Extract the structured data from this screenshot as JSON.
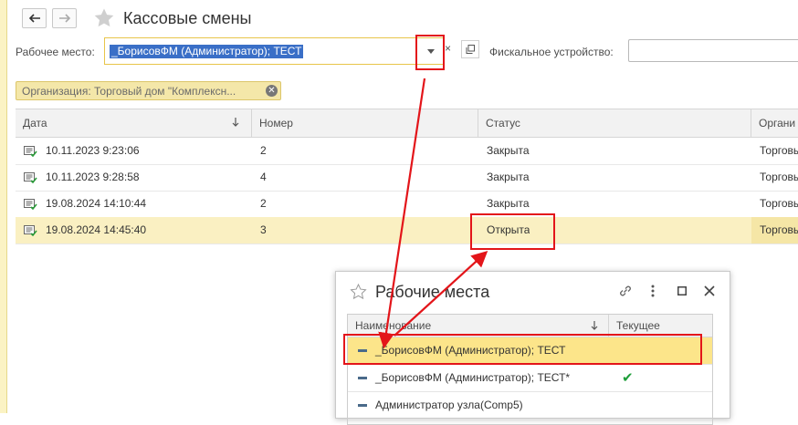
{
  "window": {
    "title": "Кассовые смены"
  },
  "filters": {
    "workplace_label": "Рабочее место:",
    "workplace_value": "_БорисовФМ (Администратор); ТЕСТ",
    "fiscal_label": "Фискальное устройство:",
    "fiscal_value": "",
    "org_chip": "Организация: Торговый дом \"Комплексн..."
  },
  "grid": {
    "columns": [
      "Дата",
      "Номер",
      "Статус",
      "Органи"
    ],
    "rows": [
      {
        "date": "10.11.2023 9:23:06",
        "number": "2",
        "status": "Закрыта",
        "org": "Торговы"
      },
      {
        "date": "10.11.2023 9:28:58",
        "number": "4",
        "status": "Закрыта",
        "org": "Торговы"
      },
      {
        "date": "19.08.2024 14:10:44",
        "number": "2",
        "status": "Закрыта",
        "org": "Торговы"
      },
      {
        "date": "19.08.2024 14:45:40",
        "number": "3",
        "status": "Открыта",
        "org": "Торговый"
      }
    ]
  },
  "popup": {
    "title": "Рабочие места",
    "columns": [
      "Наименование",
      "Текущее"
    ],
    "rows": [
      {
        "name": "_БорисовФМ (Администратор); ТЕСТ",
        "current": ""
      },
      {
        "name": "_БорисовФМ (Администратор); ТЕСТ*",
        "current": "✔"
      },
      {
        "name": "Администратор узла(Comp5)",
        "current": ""
      }
    ]
  },
  "colors": {
    "accent": "#e3151a",
    "selection": "#faf0c2",
    "highlight": "#fce58a",
    "check": "#1e9e3a"
  }
}
